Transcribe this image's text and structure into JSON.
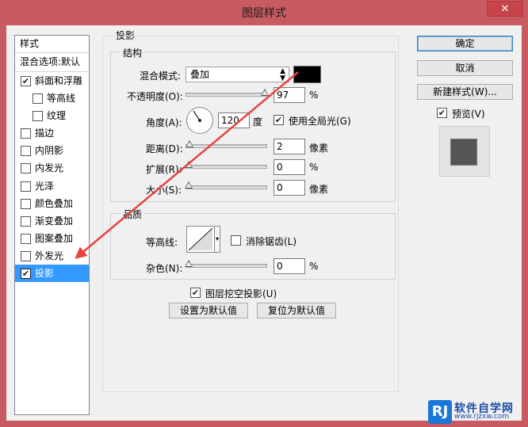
{
  "window": {
    "title": "图层样式",
    "close_glyph": "✕"
  },
  "styles_panel": {
    "header": "样式",
    "blend_options": "混合选项:默认",
    "items": [
      {
        "label": "斜面和浮雕",
        "checked": true
      },
      {
        "label": "等高线",
        "checked": false,
        "sub": true
      },
      {
        "label": "纹理",
        "checked": false,
        "sub": true
      },
      {
        "label": "描边",
        "checked": false
      },
      {
        "label": "内阴影",
        "checked": false
      },
      {
        "label": "内发光",
        "checked": false
      },
      {
        "label": "光泽",
        "checked": false
      },
      {
        "label": "颜色叠加",
        "checked": false
      },
      {
        "label": "渐变叠加",
        "checked": false
      },
      {
        "label": "图案叠加",
        "checked": false
      },
      {
        "label": "外发光",
        "checked": false
      },
      {
        "label": "投影",
        "checked": true,
        "selected": true
      }
    ]
  },
  "drop_shadow": {
    "title": "投影",
    "structure": {
      "title": "结构",
      "blend_mode_label": "混合模式:",
      "blend_mode_value": "叠加",
      "blend_color": "#000000",
      "opacity_label": "不透明度(O):",
      "opacity_value": "97",
      "opacity_unit": "%",
      "opacity_fraction": 0.97,
      "angle_label": "角度(A):",
      "angle_value": "120",
      "angle_unit": "度",
      "use_global_light_label": "使用全局光(G)",
      "use_global_light": true,
      "distance_label": "距离(D):",
      "distance_value": "2",
      "distance_unit": "像素",
      "spread_label": "扩展(R):",
      "spread_value": "0",
      "spread_unit": "%",
      "size_label": "大小(S):",
      "size_value": "0",
      "size_unit": "像素"
    },
    "quality": {
      "title": "品质",
      "contour_label": "等高线:",
      "anti_alias_label": "消除锯齿(L)",
      "anti_alias": false,
      "noise_label": "杂色(N):",
      "noise_value": "0",
      "noise_unit": "%"
    },
    "knockout_label": "图层挖空投影(U)",
    "knockout": true,
    "make_default": "设置为默认值",
    "reset_default": "复位为默认值"
  },
  "actions": {
    "ok": "确定",
    "cancel": "取消",
    "new_style": "新建样式(W)...",
    "preview_label": "预览(V)",
    "preview": true
  },
  "annotation": {
    "arrow_color": "#e8423c"
  },
  "watermark": {
    "logo": "RJ",
    "name": "软件自学网",
    "url": "www.rjzxw.com"
  }
}
